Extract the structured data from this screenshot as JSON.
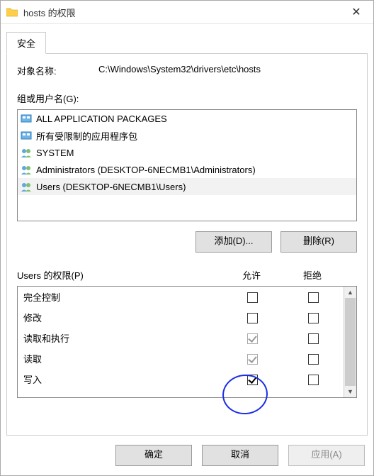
{
  "window": {
    "title": "hosts 的权限",
    "close_glyph": "✕"
  },
  "tabs": {
    "security": "安全"
  },
  "object": {
    "label": "对象名称:",
    "path": "C:\\Windows\\System32\\drivers\\etc\\hosts"
  },
  "groups": {
    "label": "组或用户名(G):",
    "items": [
      "ALL APPLICATION PACKAGES",
      "所有受限制的应用程序包",
      "SYSTEM",
      "Administrators (DESKTOP-6NECMB1\\Administrators)",
      "Users (DESKTOP-6NECMB1\\Users)"
    ],
    "selected_index": 4
  },
  "buttons": {
    "add": "添加(D)...",
    "remove": "删除(R)"
  },
  "permissions": {
    "label": "Users 的权限(P)",
    "allow_label": "允许",
    "deny_label": "拒绝",
    "rows": [
      {
        "name": "完全控制",
        "allow": "",
        "deny": ""
      },
      {
        "name": "修改",
        "allow": "",
        "deny": ""
      },
      {
        "name": "读取和执行",
        "allow": "disabled-checked",
        "deny": ""
      },
      {
        "name": "读取",
        "allow": "disabled-checked",
        "deny": ""
      },
      {
        "name": "写入",
        "allow": "checked",
        "deny": ""
      }
    ]
  },
  "dialog_buttons": {
    "ok": "确定",
    "cancel": "取消",
    "apply": "应用(A)"
  }
}
